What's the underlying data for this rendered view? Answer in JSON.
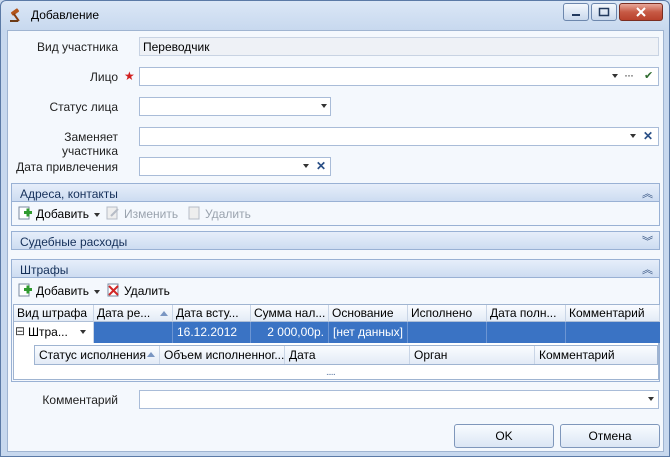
{
  "window": {
    "title": "Добавление"
  },
  "form": {
    "participant_type": {
      "label": "Вид участника",
      "value": "Переводчик"
    },
    "person": {
      "label": "Лицо",
      "required": "★"
    },
    "person_status": {
      "label": "Статус лица"
    },
    "replaces": {
      "label": "Заменяет участника"
    },
    "involve_date": {
      "label": "Дата привлечения"
    },
    "comment": {
      "label": "Комментарий"
    }
  },
  "sections": {
    "addresses": {
      "title": "Адреса, контакты",
      "add": "Добавить",
      "edit": "Изменить",
      "delete": "Удалить"
    },
    "court_costs": {
      "title": "Судебные расходы"
    },
    "fines": {
      "title": "Штрафы",
      "add": "Добавить",
      "delete": "Удалить"
    }
  },
  "fines_grid": {
    "columns": [
      "Вид штрафа",
      "Дата ре...",
      "Дата всту...",
      "Сумма нал...",
      "Основание",
      "Исполнено",
      "Дата полн...",
      "Комментарий"
    ],
    "row": {
      "type": "Штра...",
      "decision_date": "",
      "effective_date": "16.12.2012",
      "amount": "2 000,00р.",
      "basis": "[нет данных]",
      "done": "",
      "full_date": "",
      "comment": ""
    },
    "subcolumns": [
      "Статус исполнения",
      "Объем исполненног...",
      "Дата",
      "Орган",
      "Комментарий"
    ],
    "expand_symbol": "⊟",
    "resize_grip": ".....",
    "chev_up": "︽",
    "chev_down": "︾"
  },
  "buttons": {
    "ok": "OK",
    "cancel": "Отмена"
  },
  "glyphs": {
    "clear": "✕",
    "ellipsis": "···",
    "check": "✔"
  }
}
